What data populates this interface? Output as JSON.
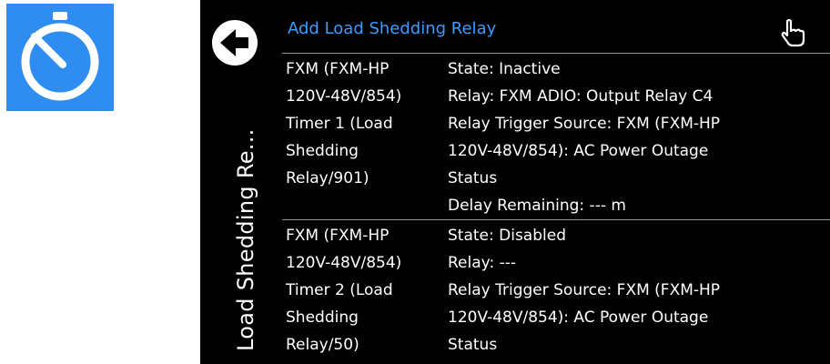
{
  "app_icon": {
    "icon": "timer-icon",
    "color": "#2f8cf1"
  },
  "side_title": "Load Shedding Re...",
  "header": {
    "title": "Add Load Shedding Relay",
    "title_color": "#3d9bff",
    "back_icon": "back-arrow-icon",
    "touch_icon": "hand-pointer-icon"
  },
  "relays": [
    {
      "name_lines": [
        "FXM (FXM-HP",
        "120V-48V/854)",
        "Timer 1 (Load",
        "Shedding",
        "Relay/901)"
      ],
      "detail_lines": [
        "State: Inactive",
        "Relay: FXM ADIO: Output Relay C4",
        "Relay Trigger Source: FXM (FXM-HP",
        "120V-48V/854): AC Power Outage",
        "Status",
        "Delay Remaining: --- m"
      ]
    },
    {
      "name_lines": [
        "FXM (FXM-HP",
        "120V-48V/854)",
        "Timer 2 (Load",
        "Shedding",
        "Relay/50)"
      ],
      "detail_lines": [
        "State: Disabled",
        "Relay: ---",
        "Relay Trigger Source: FXM (FXM-HP",
        "120V-48V/854): AC Power Outage",
        "Status"
      ]
    }
  ]
}
